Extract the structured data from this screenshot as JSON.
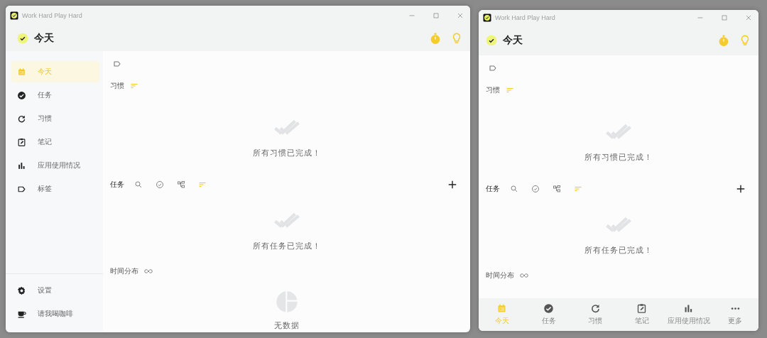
{
  "windows": [
    {
      "title": "Work Hard Play Hard",
      "header": {
        "title": "今天"
      },
      "sidebar": {
        "items": [
          {
            "label": "今天",
            "selected": true
          },
          {
            "label": "任务",
            "selected": false
          },
          {
            "label": "习惯",
            "selected": false
          },
          {
            "label": "笔记",
            "selected": false
          },
          {
            "label": "应用使用情况",
            "selected": false
          },
          {
            "label": "标签",
            "selected": false
          }
        ],
        "footer_items": [
          {
            "label": "设置"
          },
          {
            "label": "请我喝咖啡"
          }
        ]
      },
      "habits": {
        "label": "习惯",
        "empty_message": "所有习惯已完成！"
      },
      "tasks": {
        "label": "任务",
        "empty_message": "所有任务已完成！"
      },
      "time_distribution": {
        "label": "时间分布",
        "empty_message": "无数据"
      }
    },
    {
      "title": "Work Hard Play Hard",
      "header": {
        "title": "今天"
      },
      "habits": {
        "label": "习惯",
        "empty_message": "所有习惯已完成！"
      },
      "tasks": {
        "label": "任务",
        "empty_message": "所有任务已完成！"
      },
      "time_distribution": {
        "label": "时间分布"
      },
      "bottom_nav": [
        {
          "label": "今天",
          "selected": true
        },
        {
          "label": "任务",
          "selected": false
        },
        {
          "label": "习惯",
          "selected": false
        },
        {
          "label": "笔记",
          "selected": false
        },
        {
          "label": "应用使用情况",
          "selected": false
        },
        {
          "label": "更多",
          "selected": false
        }
      ]
    }
  ]
}
